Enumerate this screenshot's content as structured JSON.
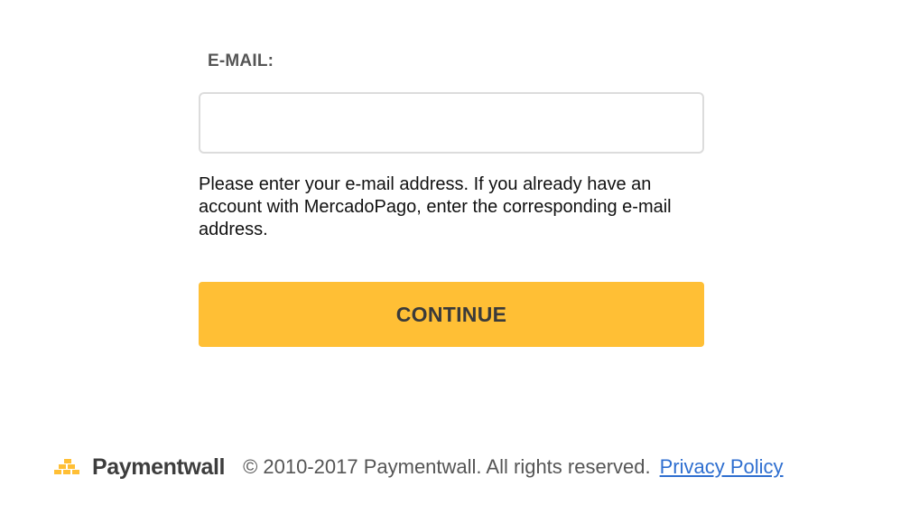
{
  "form": {
    "email_label": "E-MAIL:",
    "email_value": "",
    "email_placeholder": "",
    "help_text": "Please enter your e-mail address. If you already have an account with MercadoPago, enter the corresponding e-mail address.",
    "continue_label": "CONTINUE"
  },
  "footer": {
    "brand_icon": "paymentwall-logo-icon",
    "brand_name": "Paymentwall",
    "copyright": "© 2010-2017 Paymentwall. All rights reserved.",
    "privacy_link": "Privacy Policy"
  },
  "colors": {
    "button_bg": "#ffbf35",
    "button_text": "#3a3a3a",
    "link": "#2f6fd0",
    "brand_icon": "#ffbf35",
    "input_border": "#dcdcdc"
  }
}
